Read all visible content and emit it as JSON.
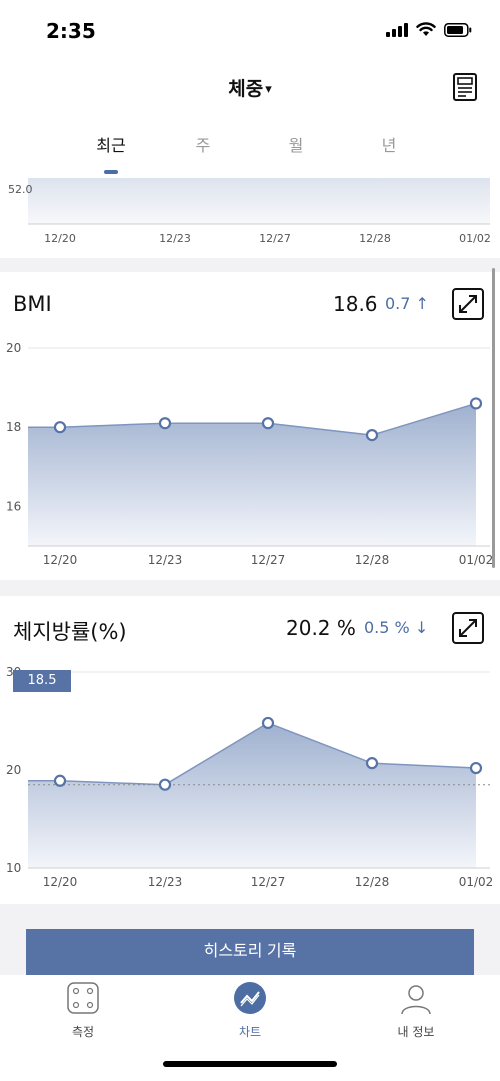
{
  "status_bar": {
    "time": "2:35"
  },
  "nav": {
    "title": "체중",
    "caret": "▾",
    "report_icon": "report-icon"
  },
  "tabs": [
    {
      "label": "최근",
      "active": true
    },
    {
      "label": "주",
      "active": false
    },
    {
      "label": "월",
      "active": false
    },
    {
      "label": "년",
      "active": false
    }
  ],
  "weight_chart": {
    "y_tick_visible": "52.0",
    "x_labels": [
      "12/20",
      "12/23",
      "12/27",
      "12/28",
      "01/02"
    ]
  },
  "bmi": {
    "title": "BMI",
    "value": "18.6",
    "delta": "0.7 ↑",
    "expand_icon": "expand-icon"
  },
  "body_fat": {
    "title": "체지방률(%)",
    "value": "20.2 %",
    "delta": "0.5 % ↓",
    "expand_icon": "expand-icon",
    "tooltip": "18.5"
  },
  "chart_data": [
    {
      "type": "area",
      "title": "BMI",
      "categories": [
        "12/20",
        "12/23",
        "12/27",
        "12/28",
        "01/02"
      ],
      "values": [
        18.0,
        18.1,
        18.1,
        17.8,
        18.6
      ],
      "yticks": [
        "20",
        "18",
        "16"
      ],
      "ylim": [
        15,
        20
      ]
    },
    {
      "type": "area",
      "title": "체지방률(%)",
      "categories": [
        "12/20",
        "12/23",
        "12/27",
        "12/28",
        "01/02"
      ],
      "values": [
        18.9,
        18.5,
        24.8,
        20.7,
        20.2
      ],
      "yticks": [
        "30",
        "20",
        "10"
      ],
      "ylim": [
        10,
        30
      ],
      "reference_line": 18.5
    }
  ],
  "history_button": {
    "label": "히스토리 기록"
  },
  "tab_bar": [
    {
      "label": "측정",
      "icon": "scale-icon",
      "active": false
    },
    {
      "label": "차트",
      "icon": "chart-icon",
      "active": true
    },
    {
      "label": "내 정보",
      "icon": "person-icon",
      "active": false
    }
  ],
  "colors": {
    "accent": "#4d6ea3",
    "area_top": "#9fb1cf",
    "area_bottom": "#f3f5fa"
  }
}
